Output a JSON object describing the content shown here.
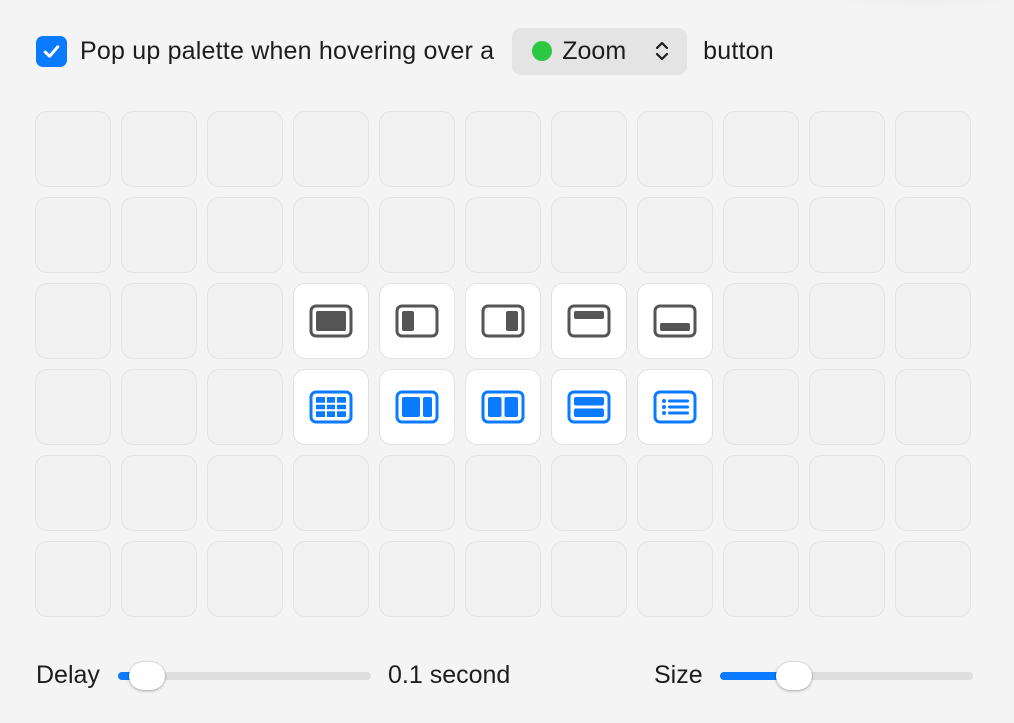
{
  "header": {
    "checkbox_checked": true,
    "prefix_text": "Pop up palette when hovering over a",
    "popup": {
      "selected": "Zoom",
      "dot_color": "#2cc841",
      "icon": "chevron-updown-icon"
    },
    "suffix_text": "button"
  },
  "palette": {
    "rows": 6,
    "columns": 11,
    "layout_icons": [
      {
        "row": 3,
        "col": 4,
        "icon": "fill-screen-icon",
        "color": "#555555"
      },
      {
        "row": 3,
        "col": 5,
        "icon": "left-half-icon",
        "color": "#555555"
      },
      {
        "row": 3,
        "col": 6,
        "icon": "right-half-icon",
        "color": "#555555"
      },
      {
        "row": 3,
        "col": 7,
        "icon": "top-half-icon",
        "color": "#555555"
      },
      {
        "row": 3,
        "col": 8,
        "icon": "bottom-half-icon",
        "color": "#555555"
      },
      {
        "row": 4,
        "col": 4,
        "icon": "grid-layout-icon",
        "color": "#0a7aff"
      },
      {
        "row": 4,
        "col": 5,
        "icon": "split-left-wide-icon",
        "color": "#0a7aff"
      },
      {
        "row": 4,
        "col": 6,
        "icon": "split-columns-icon",
        "color": "#0a7aff"
      },
      {
        "row": 4,
        "col": 7,
        "icon": "split-rows-icon",
        "color": "#0a7aff"
      },
      {
        "row": 4,
        "col": 8,
        "icon": "list-layout-icon",
        "color": "#0a7aff"
      }
    ]
  },
  "footer": {
    "delay_label": "Delay",
    "delay_value_text": "0.1 second",
    "delay_fraction": 0.05,
    "size_label": "Size",
    "size_fraction": 0.26
  },
  "colors": {
    "accent": "#0a7aff",
    "icon_gray": "#555555"
  }
}
